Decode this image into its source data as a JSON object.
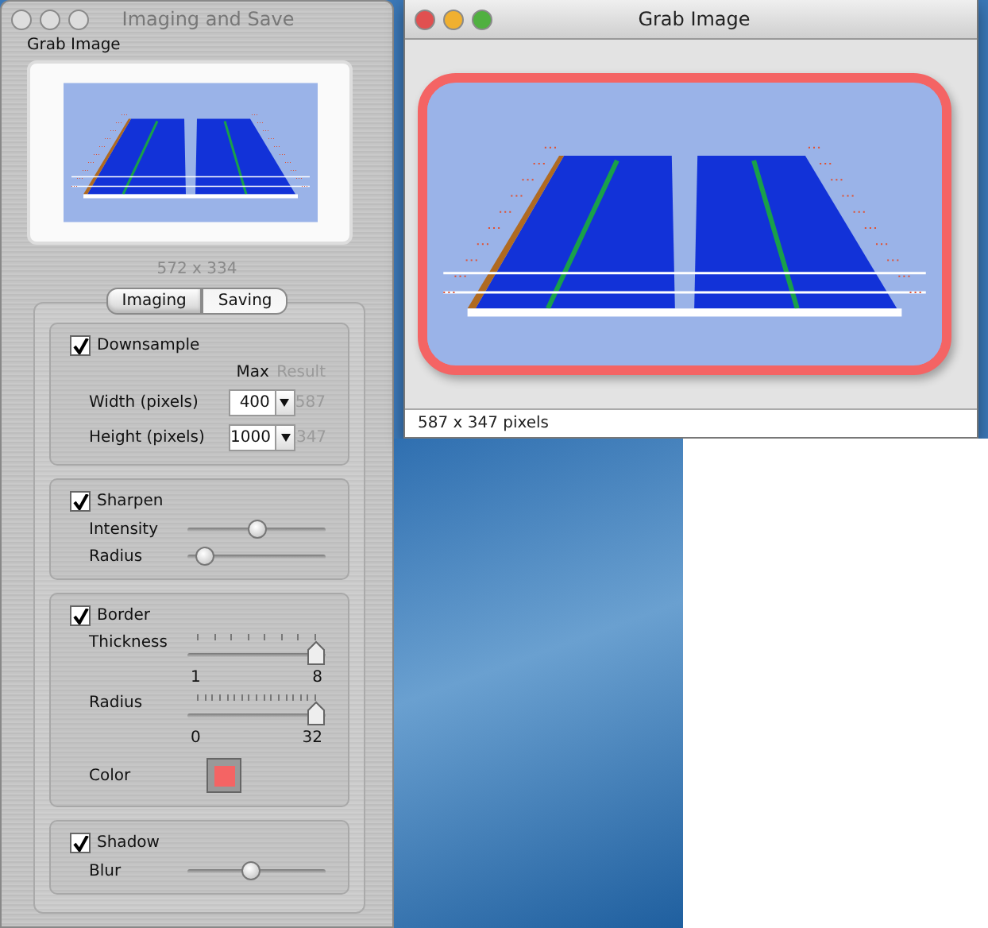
{
  "imaging_window": {
    "title": "Imaging and Save",
    "section_label": "Grab Image",
    "preview_size": "572 x 334",
    "tabs": [
      {
        "label": "Imaging",
        "selected": true
      },
      {
        "label": "Saving",
        "selected": false
      }
    ],
    "downsample": {
      "label": "Downsample",
      "checked": true,
      "col_max": "Max",
      "col_result": "Result",
      "rows": [
        {
          "label": "Width (pixels)",
          "value": "400",
          "result": "587"
        },
        {
          "label": "Height (pixels)",
          "value": "1000",
          "result": "347"
        }
      ]
    },
    "sharpen": {
      "label": "Sharpen",
      "checked": true,
      "sliders": [
        {
          "kind": "plain",
          "label": "Intensity",
          "level": 0.5
        },
        {
          "kind": "plain",
          "label": "Radius",
          "level": 0.07
        }
      ]
    },
    "border": {
      "label": "Border",
      "checked": true,
      "color_label": "Color",
      "color": "#f46464",
      "sliders": [
        {
          "kind": "ticked",
          "label": "Thickness",
          "level": 1,
          "min": "1",
          "max": "8"
        },
        {
          "kind": "ticked",
          "label": "Radius",
          "level": 1,
          "min": "0",
          "max": "32"
        }
      ]
    },
    "shadow": {
      "label": "Shadow",
      "checked": true,
      "sliders": [
        {
          "kind": "plain",
          "label": "Blur",
          "level": 0.45
        }
      ]
    }
  },
  "grab_window": {
    "title": "Grab Image",
    "status": "587 x 347 pixels"
  }
}
